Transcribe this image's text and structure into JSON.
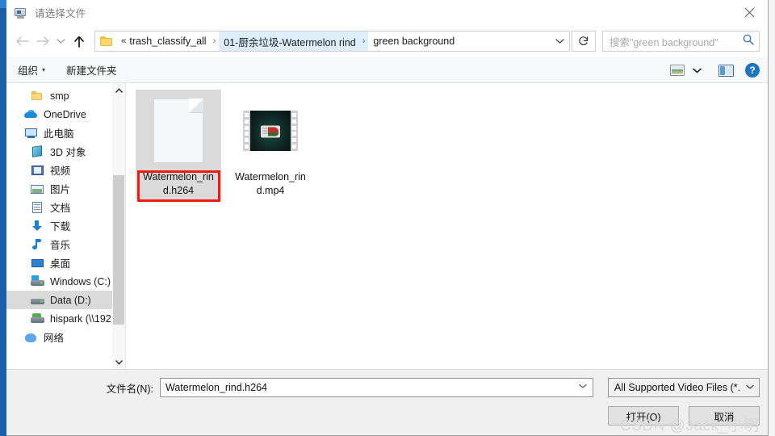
{
  "window": {
    "title": "请选择文件",
    "app_icon": "computer-icon",
    "close_label": "✕"
  },
  "nav": {
    "back": "←",
    "forward": "→",
    "recent": "⌄",
    "up": "↑",
    "refresh": "↻",
    "crumb_chevrons": "«",
    "separator": "›",
    "caret": "⌄"
  },
  "breadcrumb": {
    "items": [
      {
        "label": "trash_classify_all",
        "highlighted": false
      },
      {
        "label": "01-厨余垃圾-Watermelon rind",
        "highlighted": true
      },
      {
        "label": "green background",
        "highlighted": false
      }
    ]
  },
  "search": {
    "placeholder": "搜索\"green background\"",
    "icon": "search-icon"
  },
  "commandbar": {
    "organize": "组织",
    "new_folder": "新建文件夹",
    "dropdown_triangle": "▾",
    "view_icon": "view-mode-icon",
    "view_caret": "▾",
    "preview_pane_icon": "preview-pane-icon",
    "help_icon": "?"
  },
  "sidebar": {
    "items": [
      {
        "label": "smp",
        "icon": "folder-icon",
        "indent": true,
        "selected": false
      },
      {
        "label": "OneDrive",
        "icon": "cloud-icon",
        "indent": false,
        "selected": false
      },
      {
        "label": "此电脑",
        "icon": "computer-icon",
        "indent": false,
        "selected": false
      },
      {
        "label": "3D 对象",
        "icon": "3d-objects-icon",
        "indent": true,
        "selected": false
      },
      {
        "label": "视频",
        "icon": "videos-icon",
        "indent": true,
        "selected": false
      },
      {
        "label": "图片",
        "icon": "pictures-icon",
        "indent": true,
        "selected": false
      },
      {
        "label": "文档",
        "icon": "documents-icon",
        "indent": true,
        "selected": false
      },
      {
        "label": "下载",
        "icon": "downloads-icon",
        "indent": true,
        "selected": false
      },
      {
        "label": "音乐",
        "icon": "music-icon",
        "indent": true,
        "selected": false
      },
      {
        "label": "桌面",
        "icon": "desktop-icon",
        "indent": true,
        "selected": false
      },
      {
        "label": "Windows (C:)",
        "icon": "drive-icon",
        "indent": true,
        "selected": false
      },
      {
        "label": "Data (D:)",
        "icon": "drive-icon",
        "indent": true,
        "selected": true
      },
      {
        "label": "hispark (\\\\192.",
        "icon": "network-drive-icon",
        "indent": true,
        "selected": false
      },
      {
        "label": "网络",
        "icon": "network-icon",
        "indent": false,
        "selected": false
      }
    ],
    "scroll_up": "⌃",
    "scroll_down": "⌄"
  },
  "files": [
    {
      "name_line1": "Watermelon_rin",
      "name_line2": "d.h264",
      "icon": "blank-document-icon",
      "selected": true,
      "annotated": true
    },
    {
      "name_line1": "Watermelon_rin",
      "name_line2": "d.mp4",
      "icon": "video-thumbnail-icon",
      "selected": false,
      "annotated": false
    }
  ],
  "footer": {
    "filename_label": "文件名(N):",
    "filename_value": "Watermelon_rind.h264",
    "filename_caret": "⌄",
    "filter_value": "All Supported Video Files (*.",
    "filter_caret": "⌄",
    "open_button": "打开(O)",
    "cancel_button": "取消"
  },
  "watermark": {
    "text": "CSDN @Jack_小明"
  },
  "colors": {
    "accent_blue": "#1e74c4",
    "crumb_highlight": "#ddeefb",
    "selection_gray": "#dadada",
    "annotation_red": "#f01a0d",
    "titlebar_text": "#7a7a7a"
  }
}
